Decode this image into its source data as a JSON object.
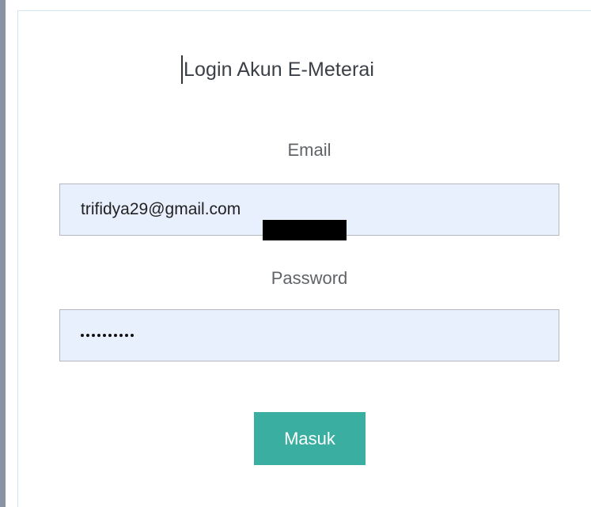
{
  "login": {
    "title": "Login Akun E-Meterai",
    "email_label": "Email",
    "email_value": "trifidya29@gmail.com",
    "password_label": "Password",
    "password_mask": "••••••••••",
    "submit_label": "Masuk"
  },
  "colors": {
    "button_bg": "#3aaea0",
    "field_bg": "#e8f0fe",
    "card_border": "#cfe6ef"
  }
}
